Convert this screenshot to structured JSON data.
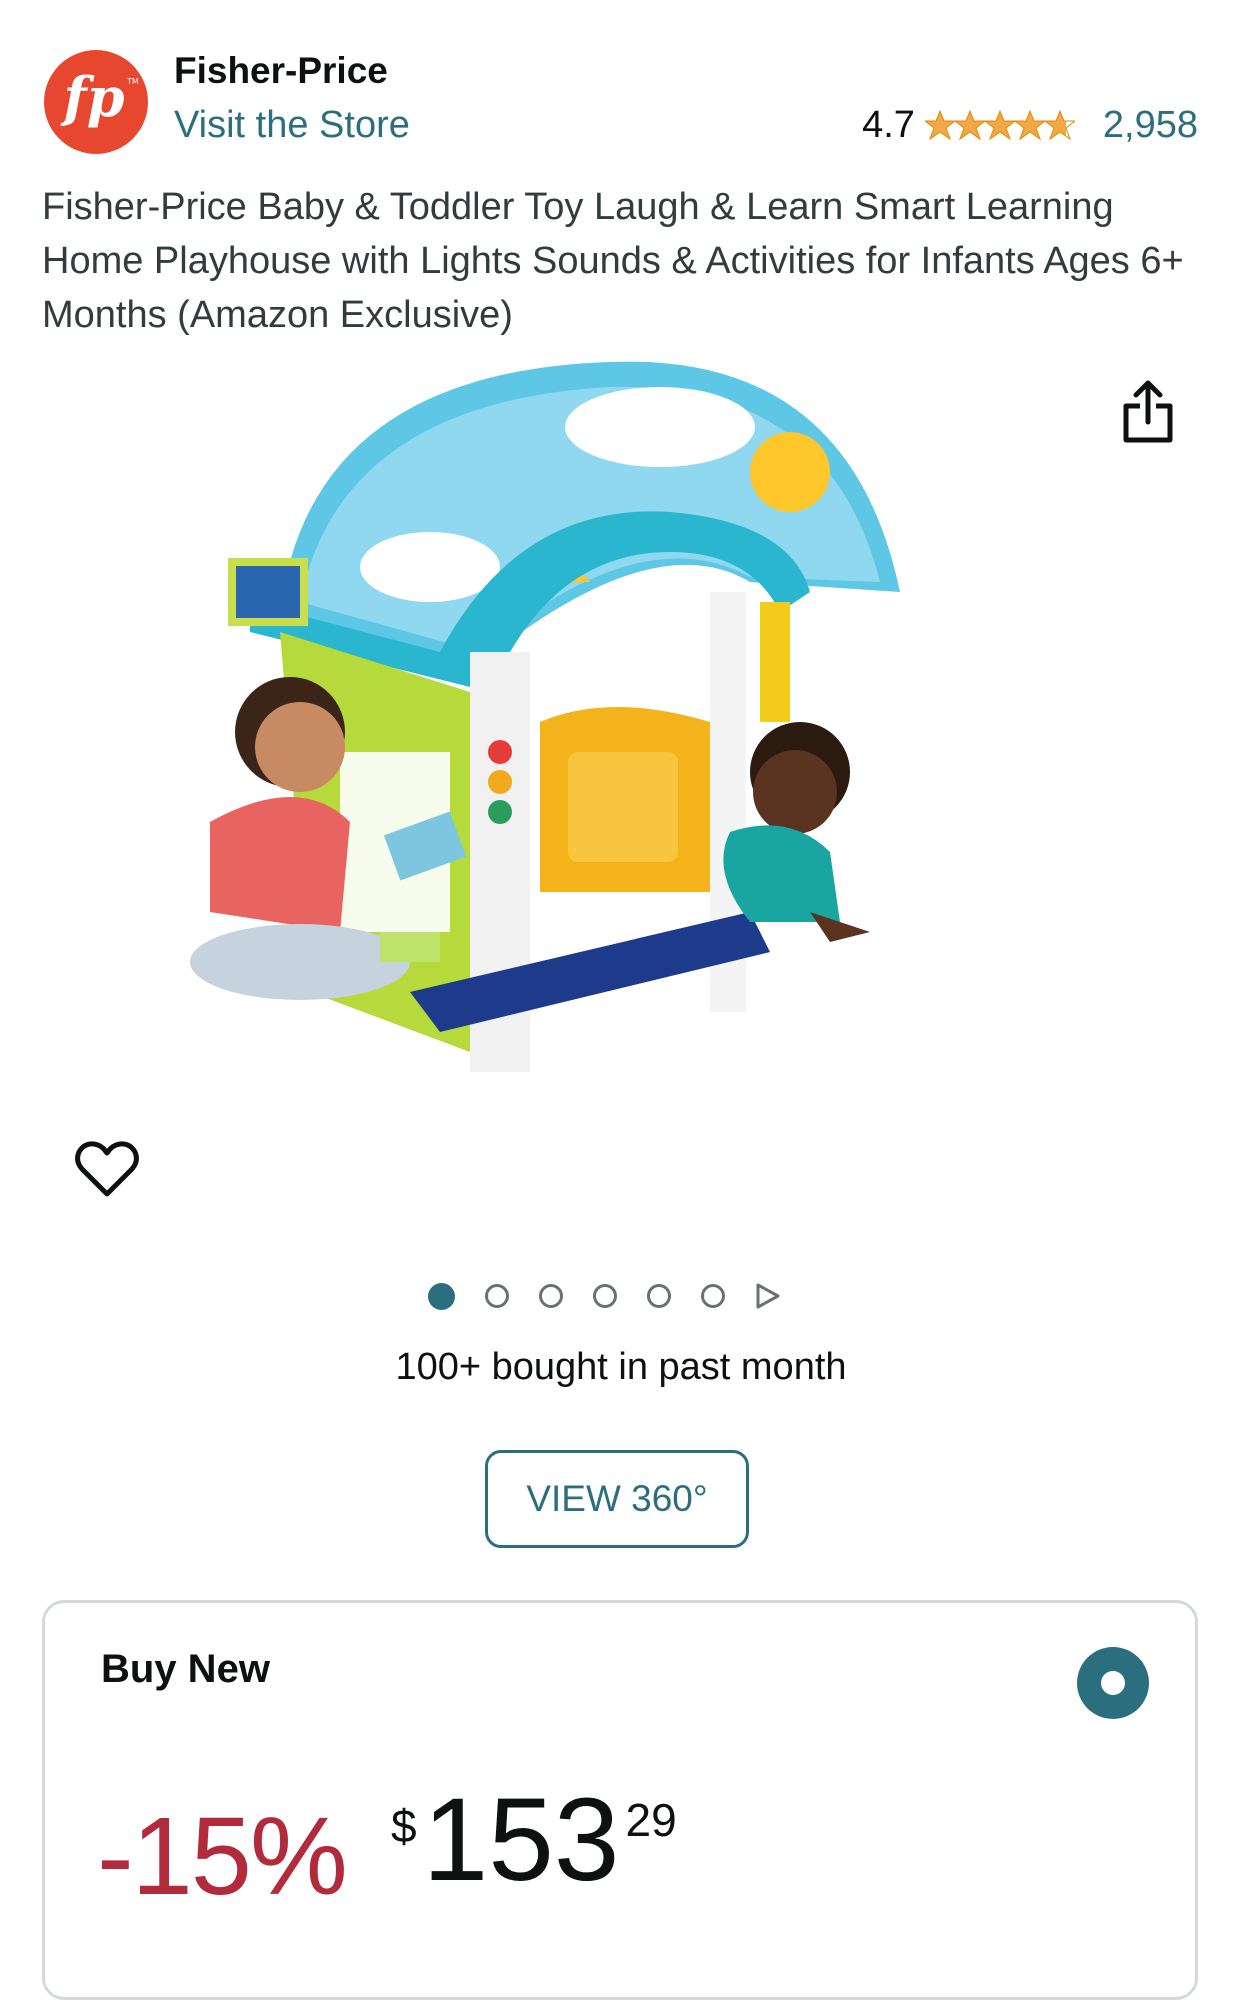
{
  "brand": {
    "logo_text": "fp",
    "name": "Fisher-Price",
    "visit_store_label": "Visit the Store"
  },
  "rating": {
    "value": "4.7",
    "stars": 4.7,
    "review_count": "2,958"
  },
  "product": {
    "title": "Fisher-Price Baby & Toddler Toy Laugh & Learn Smart Learning Home Playhouse with Lights Sounds & Activities for Infants Ages 6+ Months (Amazon Exclusive)",
    "image_icon": "toy-playhouse-image"
  },
  "carousel": {
    "total_images": 6,
    "active_index": 0
  },
  "bought_text": "100+ bought in past month",
  "view360_label": "VIEW 360°",
  "buy_new": {
    "title": "Buy New",
    "discount": "-15%",
    "price_symbol": "$",
    "price_whole": "153",
    "price_fraction": "29"
  },
  "colors": {
    "link": "#2b6f7f",
    "discount": "#b12b3c",
    "star": "#f3a847",
    "logo": "#e8472f"
  }
}
